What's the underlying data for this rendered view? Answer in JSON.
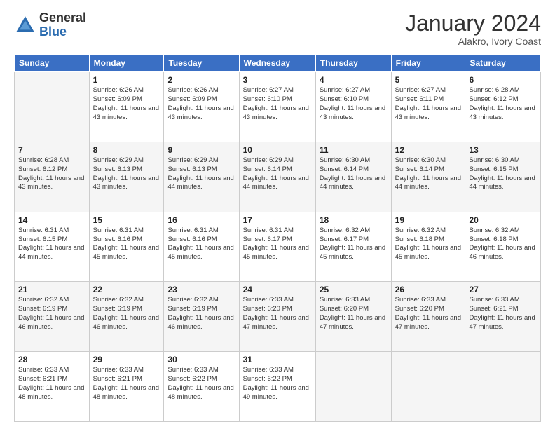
{
  "header": {
    "logo_general": "General",
    "logo_blue": "Blue",
    "month_title": "January 2024",
    "subtitle": "Alakro, Ivory Coast"
  },
  "weekdays": [
    "Sunday",
    "Monday",
    "Tuesday",
    "Wednesday",
    "Thursday",
    "Friday",
    "Saturday"
  ],
  "weeks": [
    [
      {
        "day": "",
        "sunrise": "",
        "sunset": "",
        "daylight": ""
      },
      {
        "day": "1",
        "sunrise": "Sunrise: 6:26 AM",
        "sunset": "Sunset: 6:09 PM",
        "daylight": "Daylight: 11 hours and 43 minutes."
      },
      {
        "day": "2",
        "sunrise": "Sunrise: 6:26 AM",
        "sunset": "Sunset: 6:09 PM",
        "daylight": "Daylight: 11 hours and 43 minutes."
      },
      {
        "day": "3",
        "sunrise": "Sunrise: 6:27 AM",
        "sunset": "Sunset: 6:10 PM",
        "daylight": "Daylight: 11 hours and 43 minutes."
      },
      {
        "day": "4",
        "sunrise": "Sunrise: 6:27 AM",
        "sunset": "Sunset: 6:10 PM",
        "daylight": "Daylight: 11 hours and 43 minutes."
      },
      {
        "day": "5",
        "sunrise": "Sunrise: 6:27 AM",
        "sunset": "Sunset: 6:11 PM",
        "daylight": "Daylight: 11 hours and 43 minutes."
      },
      {
        "day": "6",
        "sunrise": "Sunrise: 6:28 AM",
        "sunset": "Sunset: 6:12 PM",
        "daylight": "Daylight: 11 hours and 43 minutes."
      }
    ],
    [
      {
        "day": "7",
        "sunrise": "Sunrise: 6:28 AM",
        "sunset": "Sunset: 6:12 PM",
        "daylight": "Daylight: 11 hours and 43 minutes."
      },
      {
        "day": "8",
        "sunrise": "Sunrise: 6:29 AM",
        "sunset": "Sunset: 6:13 PM",
        "daylight": "Daylight: 11 hours and 43 minutes."
      },
      {
        "day": "9",
        "sunrise": "Sunrise: 6:29 AM",
        "sunset": "Sunset: 6:13 PM",
        "daylight": "Daylight: 11 hours and 44 minutes."
      },
      {
        "day": "10",
        "sunrise": "Sunrise: 6:29 AM",
        "sunset": "Sunset: 6:14 PM",
        "daylight": "Daylight: 11 hours and 44 minutes."
      },
      {
        "day": "11",
        "sunrise": "Sunrise: 6:30 AM",
        "sunset": "Sunset: 6:14 PM",
        "daylight": "Daylight: 11 hours and 44 minutes."
      },
      {
        "day": "12",
        "sunrise": "Sunrise: 6:30 AM",
        "sunset": "Sunset: 6:14 PM",
        "daylight": "Daylight: 11 hours and 44 minutes."
      },
      {
        "day": "13",
        "sunrise": "Sunrise: 6:30 AM",
        "sunset": "Sunset: 6:15 PM",
        "daylight": "Daylight: 11 hours and 44 minutes."
      }
    ],
    [
      {
        "day": "14",
        "sunrise": "Sunrise: 6:31 AM",
        "sunset": "Sunset: 6:15 PM",
        "daylight": "Daylight: 11 hours and 44 minutes."
      },
      {
        "day": "15",
        "sunrise": "Sunrise: 6:31 AM",
        "sunset": "Sunset: 6:16 PM",
        "daylight": "Daylight: 11 hours and 45 minutes."
      },
      {
        "day": "16",
        "sunrise": "Sunrise: 6:31 AM",
        "sunset": "Sunset: 6:16 PM",
        "daylight": "Daylight: 11 hours and 45 minutes."
      },
      {
        "day": "17",
        "sunrise": "Sunrise: 6:31 AM",
        "sunset": "Sunset: 6:17 PM",
        "daylight": "Daylight: 11 hours and 45 minutes."
      },
      {
        "day": "18",
        "sunrise": "Sunrise: 6:32 AM",
        "sunset": "Sunset: 6:17 PM",
        "daylight": "Daylight: 11 hours and 45 minutes."
      },
      {
        "day": "19",
        "sunrise": "Sunrise: 6:32 AM",
        "sunset": "Sunset: 6:18 PM",
        "daylight": "Daylight: 11 hours and 45 minutes."
      },
      {
        "day": "20",
        "sunrise": "Sunrise: 6:32 AM",
        "sunset": "Sunset: 6:18 PM",
        "daylight": "Daylight: 11 hours and 46 minutes."
      }
    ],
    [
      {
        "day": "21",
        "sunrise": "Sunrise: 6:32 AM",
        "sunset": "Sunset: 6:19 PM",
        "daylight": "Daylight: 11 hours and 46 minutes."
      },
      {
        "day": "22",
        "sunrise": "Sunrise: 6:32 AM",
        "sunset": "Sunset: 6:19 PM",
        "daylight": "Daylight: 11 hours and 46 minutes."
      },
      {
        "day": "23",
        "sunrise": "Sunrise: 6:32 AM",
        "sunset": "Sunset: 6:19 PM",
        "daylight": "Daylight: 11 hours and 46 minutes."
      },
      {
        "day": "24",
        "sunrise": "Sunrise: 6:33 AM",
        "sunset": "Sunset: 6:20 PM",
        "daylight": "Daylight: 11 hours and 47 minutes."
      },
      {
        "day": "25",
        "sunrise": "Sunrise: 6:33 AM",
        "sunset": "Sunset: 6:20 PM",
        "daylight": "Daylight: 11 hours and 47 minutes."
      },
      {
        "day": "26",
        "sunrise": "Sunrise: 6:33 AM",
        "sunset": "Sunset: 6:20 PM",
        "daylight": "Daylight: 11 hours and 47 minutes."
      },
      {
        "day": "27",
        "sunrise": "Sunrise: 6:33 AM",
        "sunset": "Sunset: 6:21 PM",
        "daylight": "Daylight: 11 hours and 47 minutes."
      }
    ],
    [
      {
        "day": "28",
        "sunrise": "Sunrise: 6:33 AM",
        "sunset": "Sunset: 6:21 PM",
        "daylight": "Daylight: 11 hours and 48 minutes."
      },
      {
        "day": "29",
        "sunrise": "Sunrise: 6:33 AM",
        "sunset": "Sunset: 6:21 PM",
        "daylight": "Daylight: 11 hours and 48 minutes."
      },
      {
        "day": "30",
        "sunrise": "Sunrise: 6:33 AM",
        "sunset": "Sunset: 6:22 PM",
        "daylight": "Daylight: 11 hours and 48 minutes."
      },
      {
        "day": "31",
        "sunrise": "Sunrise: 6:33 AM",
        "sunset": "Sunset: 6:22 PM",
        "daylight": "Daylight: 11 hours and 49 minutes."
      },
      {
        "day": "",
        "sunrise": "",
        "sunset": "",
        "daylight": ""
      },
      {
        "day": "",
        "sunrise": "",
        "sunset": "",
        "daylight": ""
      },
      {
        "day": "",
        "sunrise": "",
        "sunset": "",
        "daylight": ""
      }
    ]
  ]
}
